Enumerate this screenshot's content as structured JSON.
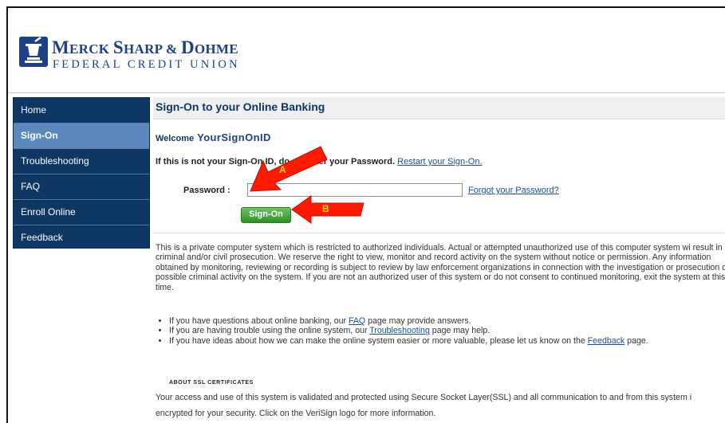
{
  "header": {
    "brand_name_parts": [
      "M",
      "ERCK ",
      "S",
      "HARP & ",
      "D",
      "OHME"
    ],
    "brand_sub": "FEDERAL CREDIT UNION"
  },
  "sidebar": {
    "items": [
      {
        "label": "Home",
        "active": false
      },
      {
        "label": "Sign-On",
        "active": true
      },
      {
        "label": "Troubleshooting",
        "active": false
      },
      {
        "label": "FAQ",
        "active": false
      },
      {
        "label": "Enroll Online",
        "active": false
      },
      {
        "label": "Feedback",
        "active": false
      }
    ]
  },
  "main": {
    "title": "Sign-On to your Online Banking",
    "welcome_label": "Welcome",
    "signon_id": "YourSignOnID",
    "not_you_prefix": "If this is not your Sign-On ID, do",
    "not_you_suffix": "ter your Password.",
    "restart_link": "Restart your Sign-On.",
    "password_label": "Password :",
    "password_value": "",
    "forgot_link": "Forgot your Password?",
    "signon_button": "Sign-On",
    "disclaimer": "This is a private computer system which is restricted to authorized individuals. Actual or attempted unauthorized use of this computer system wi result in criminal and/or civil prosecution. We reserve the right to view, monitor and record activity on the system without notice or permission. Any information obtained by monitoring, reviewing or recording is subject to review by law enforcement organizations in connection with the investigation or prosecution of possible criminal activity on the system. If you are not an authorized user of this system or do not consent to continued monitoring, exit the system at this time.",
    "bullets": [
      {
        "pre": "If you have questions about online banking, our ",
        "link": "FAQ",
        "post": " page may provide answers."
      },
      {
        "pre": "If you are having trouble using the online system, our ",
        "link": "Troubleshooting",
        "post": " page may help."
      },
      {
        "pre": "If you have ideas about how we can make the online system easier or more valuable, please let us know on the ",
        "link": "Feedback",
        "post": " page."
      }
    ],
    "ssl_heading": "ABOUT SSL CERTIFICATES",
    "ssl_line1": "Your access and use of this system is validated and protected using Secure Socket Layer(SSL) and all communication to and from this system i",
    "ssl_line2": "encrypted for your security. Click on the VeriSign logo for more information."
  },
  "annotations": {
    "arrow_a_label": "A",
    "arrow_b_label": "B",
    "arrow_color": "#ff1a00",
    "label_color": "#ffd400"
  },
  "colors": {
    "navy": "#0e3766",
    "brand_blue": "#1f3f86",
    "active_nav": "#5b89bd",
    "button_green": "#2d8f27"
  }
}
